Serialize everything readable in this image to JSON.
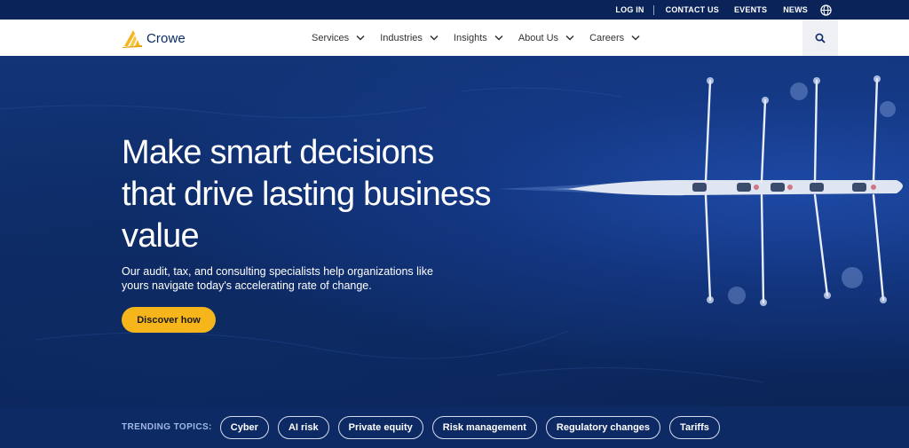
{
  "utility_nav": {
    "login": "LOG IN",
    "contact": "CONTACT US",
    "events": "EVENTS",
    "news": "NEWS",
    "globe_icon": "globe-icon"
  },
  "header": {
    "logo_text": "Crowe",
    "nav": [
      {
        "label": "Services"
      },
      {
        "label": "Industries"
      },
      {
        "label": "Insights"
      },
      {
        "label": "About Us"
      },
      {
        "label": "Careers"
      }
    ],
    "search_icon": "search-icon"
  },
  "hero": {
    "title": "Make smart decisions that drive lasting business value",
    "subtitle": "Our audit, tax, and consulting specialists help organizations like yours navigate today's accelerating rate of change.",
    "cta": "Discover how"
  },
  "trending": {
    "label": "TRENDING TOPICS:",
    "topics": [
      "Cyber",
      "AI risk",
      "Private equity",
      "Risk management",
      "Regulatory changes",
      "Tariffs"
    ]
  },
  "colors": {
    "brand_navy": "#0b2a63",
    "hero_blue": "#123578",
    "accent_gold": "#f5b51b",
    "utility_bar": "#0a2459"
  }
}
